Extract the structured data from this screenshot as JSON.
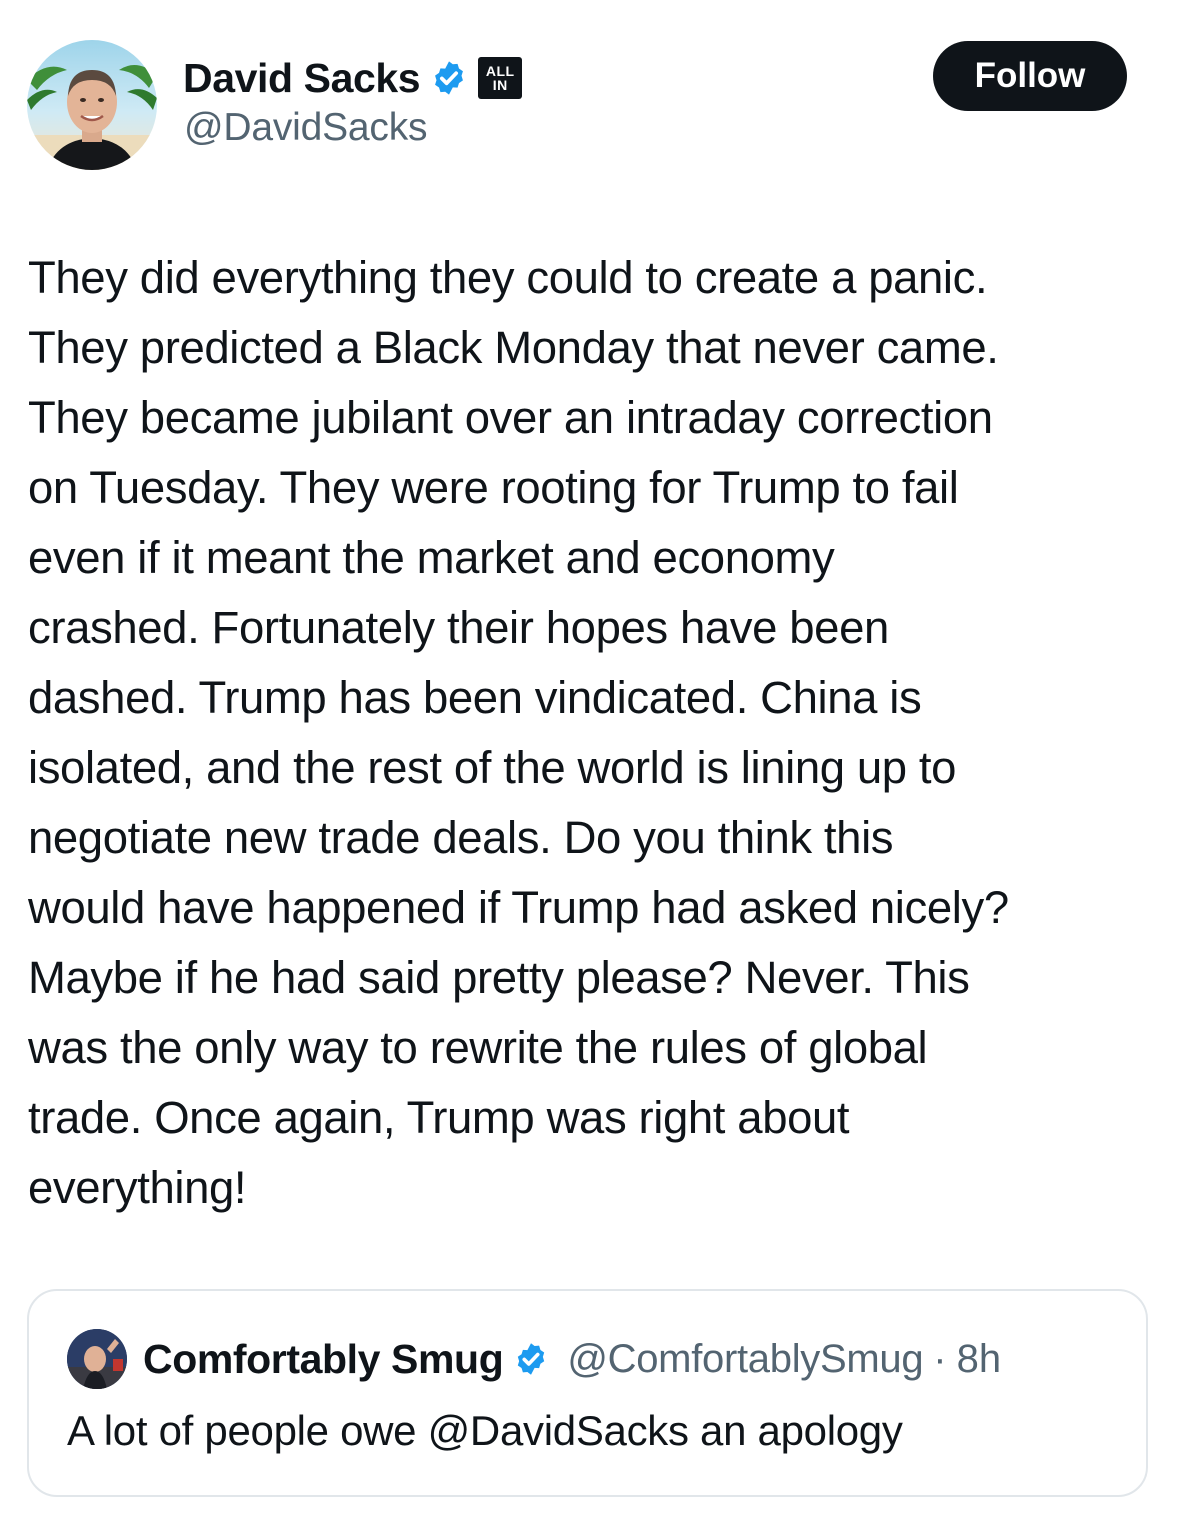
{
  "author": {
    "display_name": "David Sacks",
    "handle": "@DavidSacks",
    "verified_icon": "verified-check-icon",
    "affiliate_badge": {
      "line1": "ALL",
      "line2": "IN"
    }
  },
  "actions": {
    "follow_label": "Follow"
  },
  "tweet": {
    "lines": [
      "They did everything they could to create a panic.",
      "They predicted a Black Monday that never came.",
      "They became jubilant over an intraday correction",
      "on Tuesday. They were rooting for Trump to fail",
      "even if it meant the market and economy",
      "crashed. Fortunately their hopes have been",
      "dashed. Trump has been vindicated. China is",
      "isolated, and the rest of the world is lining up to",
      "negotiate new trade deals. Do you think this",
      "would have happened if Trump had asked nicely?",
      "Maybe if he had said pretty please? Never. This",
      "was the only way to rewrite the rules of global",
      "trade. Once again, Trump was right about",
      "everything!"
    ]
  },
  "quoted_tweet": {
    "display_name": "Comfortably Smug",
    "handle": "@ComfortablySmug",
    "separator": "·",
    "time": "8h",
    "text": "A lot of people owe @DavidSacks an apology"
  },
  "colors": {
    "text": "#0f1419",
    "secondary": "#536471",
    "verified_blue": "#1d9bf0",
    "button_bg": "#0f1419",
    "card_border": "#e1e6ea"
  }
}
